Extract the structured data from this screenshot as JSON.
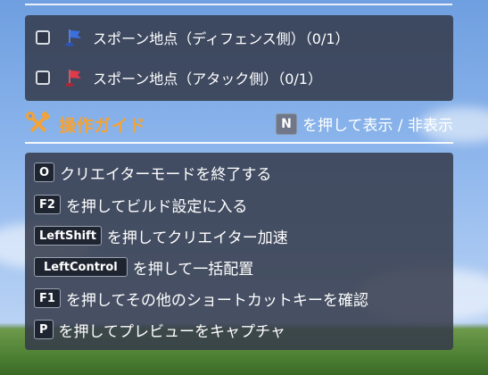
{
  "spawn_points": [
    {
      "label": "スポーン地点（ディフェンス側）（0/1）",
      "checked": false,
      "flag_color": "#3b6fe0",
      "icon": "blue-flag-icon"
    },
    {
      "label": "スポーン地点（アタック側）（0/1）",
      "checked": false,
      "flag_color": "#e03b4a",
      "icon": "red-flag-icon"
    }
  ],
  "guide": {
    "title": "操作ガイド",
    "title_color": "#f2a33a",
    "toggle_key": "N",
    "toggle_text": "を押して表示 / 非表示",
    "items": [
      {
        "key": "O",
        "text": "クリエイターモードを終了する"
      },
      {
        "key": "F2",
        "text": "を押してビルド設定に入る"
      },
      {
        "key": "LeftShift",
        "text": "を押してクリエイター加速"
      },
      {
        "key": "LeftControl",
        "text": "を押して一括配置"
      },
      {
        "key": "F1",
        "text": "を押してその他のショートカットキーを確認"
      },
      {
        "key": "P",
        "text": "を押してプレビューをキャプチャ"
      }
    ]
  }
}
